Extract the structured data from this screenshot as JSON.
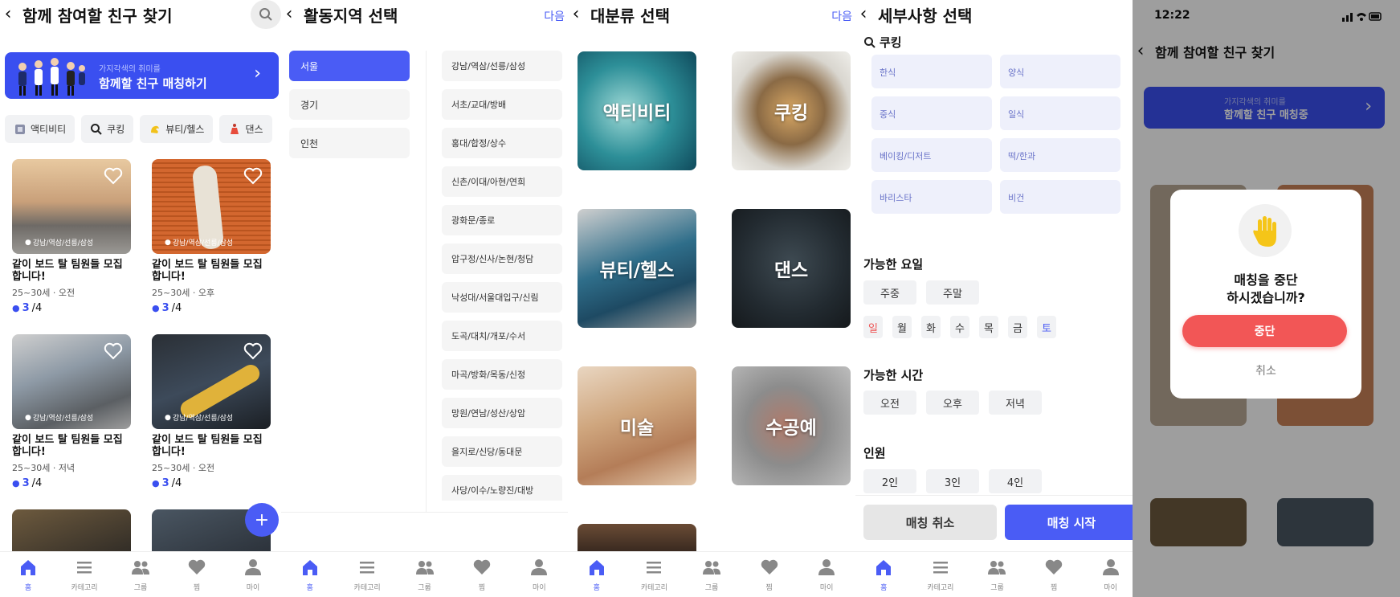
{
  "s1": {
    "title": "함께 참여할 친구 찾기",
    "banner": {
      "sub": "가지각색의 취미를",
      "main": "함께할 친구 매칭하기"
    },
    "chips": [
      "액티비티",
      "쿠킹",
      "뷰티/헬스",
      "댄스"
    ],
    "cards": [
      {
        "loc": "강남/역삼/선릉/삼성",
        "title1": "같이 보드 탈 팀원들 모집",
        "title2": "합니다!",
        "meta": "25~30세 · 오전",
        "count_now": "3",
        "count_total": "/4"
      },
      {
        "loc": "강남/역삼/선릉/삼성",
        "title1": "같이 보드 탈 팀원들 모집",
        "title2": "합니다!",
        "meta": "25~30세 · 오후",
        "count_now": "3",
        "count_total": "/4"
      },
      {
        "loc": "강남/역삼/선릉/삼성",
        "title1": "같이 보드 탈 팀원들 모집",
        "title2": "합니다!",
        "meta": "25~30세 · 저녁",
        "count_now": "3",
        "count_total": "/4"
      },
      {
        "loc": "강남/역삼/선릉/삼성",
        "title1": "같이 보드 탈 팀원들 모집",
        "title2": "합니다!",
        "meta": "25~30세 · 오전",
        "count_now": "3",
        "count_total": "/4"
      }
    ],
    "fab": "+"
  },
  "s2": {
    "title": "활동지역 선택",
    "next": "다음",
    "regions": [
      "서울",
      "경기",
      "인천"
    ],
    "subregions": [
      "강남/역삼/선릉/삼성",
      "서초/교대/방배",
      "홍대/합정/상수",
      "신촌/이대/아현/연희",
      "광화문/종로",
      "압구정/신사/논현/청담",
      "낙성대/서울대입구/신림",
      "도곡/대치/개포/수서",
      "마곡/방화/목동/신정",
      "망원/연남/성산/상암",
      "을지로/신당/동대문",
      "사당/이수/노량진/대방"
    ]
  },
  "s3": {
    "title": "대분류 선택",
    "next": "다음",
    "categories": [
      "액티비티",
      "쿠킹",
      "뷰티/헬스",
      "댄스",
      "미술",
      "수공예"
    ]
  },
  "s4": {
    "title": "세부사항 선택",
    "section_cooking": "쿠킹",
    "options": [
      "한식",
      "양식",
      "중식",
      "일식",
      "베이킹/디저트",
      "떡/한과",
      "바리스타",
      "비건"
    ],
    "days_title": "가능한 요일",
    "week": [
      "주중",
      "주말"
    ],
    "days": [
      "일",
      "월",
      "화",
      "수",
      "목",
      "금",
      "토"
    ],
    "time_title": "가능한 시간",
    "times": [
      "오전",
      "오후",
      "저녁"
    ],
    "people_title": "인원",
    "people": [
      "2인",
      "3인",
      "4인"
    ],
    "cancel": "매칭 취소",
    "start": "매칭 시작"
  },
  "s5": {
    "time": "12:22",
    "title": "함께 참여할 친구 찾기",
    "banner_sub": "가지각색의 취미를",
    "banner_main": "함께할 친구 매칭중",
    "modal_line1": "매칭을 중단",
    "modal_line2": "하시겠습니까?",
    "ok": "중단",
    "cancel": "취소"
  },
  "nav": [
    "홈",
    "카테고리",
    "그룹",
    "찜",
    "마이"
  ],
  "colors": {
    "accent": "#4a5cf5",
    "danger": "#f25656"
  }
}
